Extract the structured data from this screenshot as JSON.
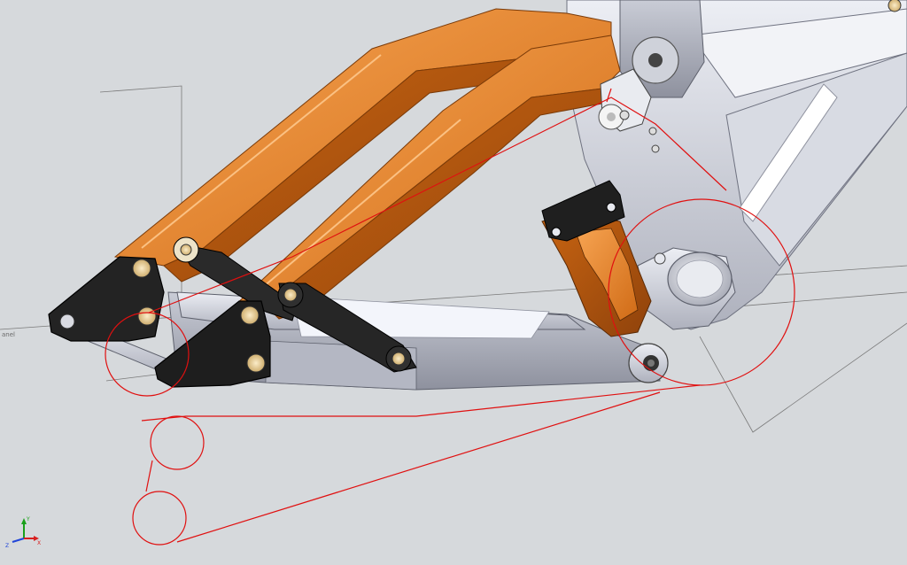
{
  "viewport": {
    "plane_label": "anel",
    "triad": {
      "x_label": "X",
      "y_label": "Y",
      "z_label": "Z"
    }
  },
  "colors": {
    "background": "#d6d9dc",
    "orange_light": "#f29640",
    "orange_mid": "#e07a1f",
    "orange_dark": "#a8500f",
    "grey_light": "#e6e8ee",
    "grey_mid": "#c4c7d0",
    "grey_dark": "#9a9daa",
    "black_link": "#222222",
    "bushing": "#f0d9a8",
    "chain_line": "#e01010",
    "sketch_line": "#7a7a7a"
  },
  "icons": {
    "axis_triad": "xyz-triad-icon",
    "bolt": "hex-bolt-icon"
  }
}
